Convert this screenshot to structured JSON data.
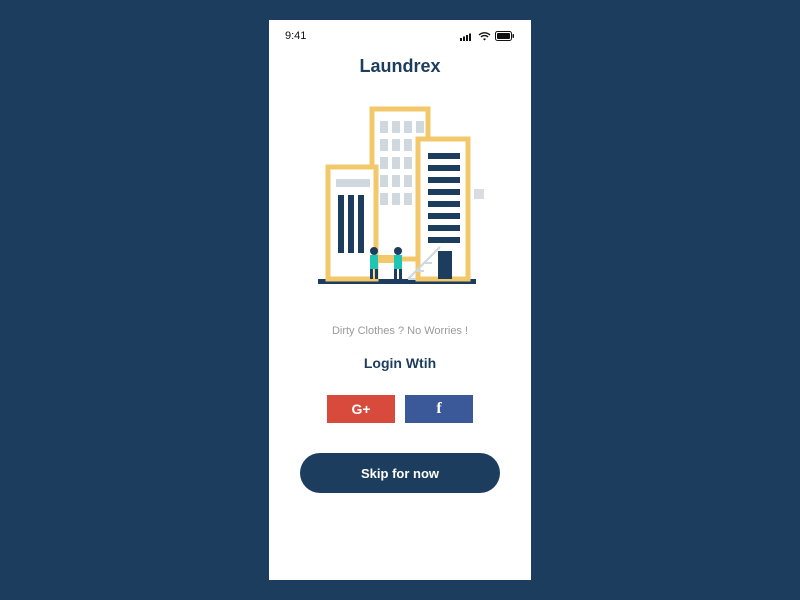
{
  "status": {
    "time": "9:41"
  },
  "app": {
    "title": "Laundrex",
    "tagline": "Dirty Clothes ? No Worries !"
  },
  "login": {
    "heading": "Login Wtih"
  },
  "buttons": {
    "skip": "Skip for now"
  },
  "icons": {
    "google": "G+",
    "facebook": "f"
  },
  "colors": {
    "background": "#1d3d5e",
    "google": "#d84b3c",
    "facebook": "#3b5998",
    "accent_yellow": "#f3c86b",
    "accent_teal": "#1fc6b5"
  }
}
